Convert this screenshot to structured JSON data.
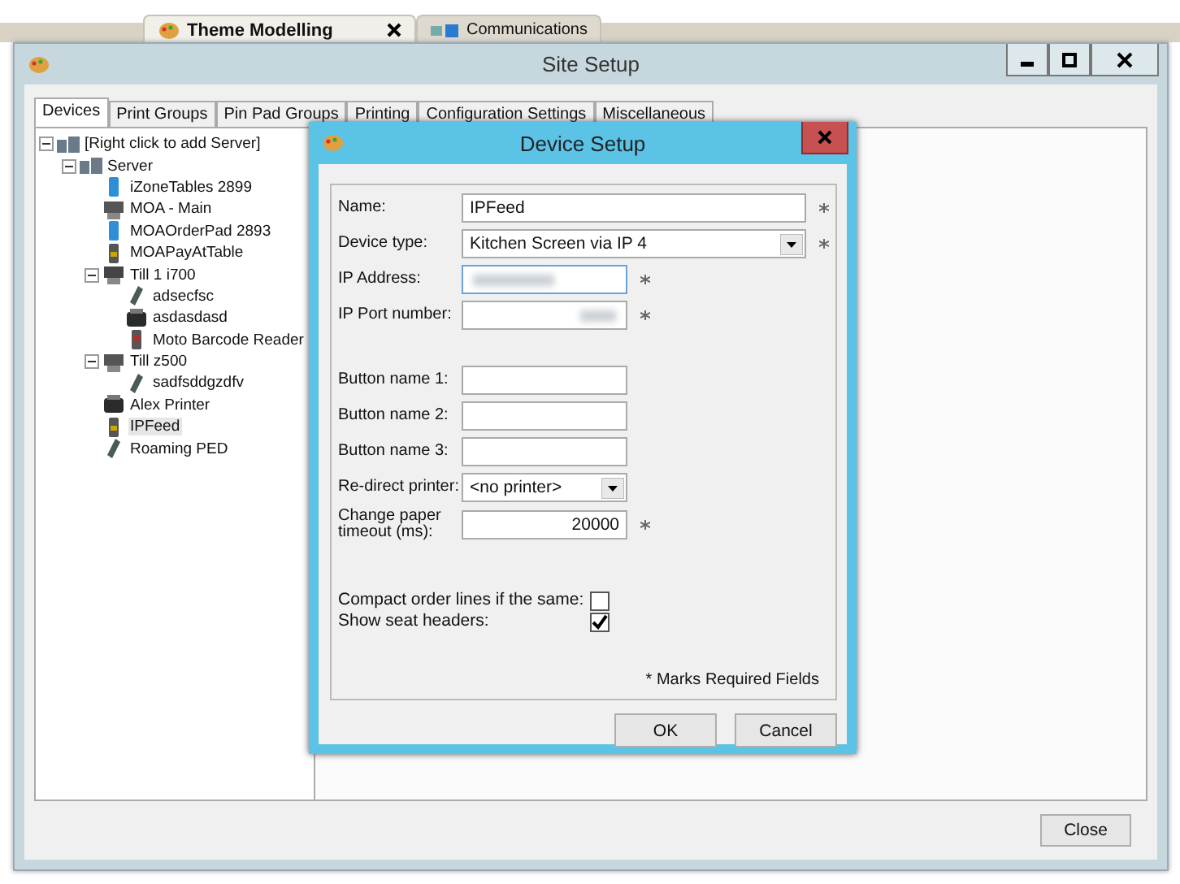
{
  "app_tabs": [
    {
      "label": "Theme Modelling",
      "selected": true,
      "closable": true
    },
    {
      "label": "Communications",
      "selected": false,
      "closable": false
    }
  ],
  "window": {
    "title": "Site Setup"
  },
  "tabs": [
    {
      "label": "Devices",
      "selected": true
    },
    {
      "label": "Print Groups",
      "selected": false
    },
    {
      "label": "Pin Pad Groups",
      "selected": false
    },
    {
      "label": "Printing",
      "selected": false
    },
    {
      "label": "Configuration Settings",
      "selected": false
    },
    {
      "label": "Miscellaneous",
      "selected": false
    }
  ],
  "tree": [
    {
      "label": "[Right click to add Server]",
      "kind": "server",
      "expanded": true,
      "selected": false,
      "children": [
        {
          "label": "Server",
          "kind": "server",
          "expanded": true,
          "selected": false,
          "children": [
            {
              "label": "iZoneTables 2899",
              "kind": "tablet",
              "selected": false
            },
            {
              "label": "MOA - Main",
              "kind": "terminal",
              "selected": false
            },
            {
              "label": "MOAOrderPad 2893",
              "kind": "tablet",
              "selected": false
            },
            {
              "label": "MOAPayAtTable",
              "kind": "payterminal",
              "selected": false
            },
            {
              "label": "Till 1 i700",
              "kind": "till",
              "expanded": true,
              "selected": false,
              "children": [
                {
                  "label": "adsecfsc",
                  "kind": "handheld",
                  "selected": false
                },
                {
                  "label": "asdasdasd",
                  "kind": "printer",
                  "selected": false
                },
                {
                  "label": "Moto Barcode Reader",
                  "kind": "scanner",
                  "selected": false
                }
              ]
            },
            {
              "label": "Till z500",
              "kind": "terminal",
              "expanded": true,
              "selected": false,
              "children": [
                {
                  "label": "sadfsddgzdfv",
                  "kind": "handheld",
                  "selected": false
                }
              ]
            },
            {
              "label": "Alex Printer",
              "kind": "printer",
              "selected": false
            },
            {
              "label": "IPFeed",
              "kind": "payterminal",
              "selected": true
            },
            {
              "label": "Roaming PED",
              "kind": "handheld",
              "selected": false
            }
          ]
        }
      ]
    }
  ],
  "dialog": {
    "title": "Device Setup",
    "fields": [
      {
        "label": "Name:",
        "kind": "text",
        "value": "IPFeed",
        "wide": true,
        "required": true,
        "right_aligned": false,
        "focused": false
      },
      {
        "label": "Device type:",
        "kind": "select",
        "value": "Kitchen Screen via IP 4",
        "wide": true,
        "required": true,
        "right_aligned": false,
        "focused": false
      },
      {
        "label": "IP Address:",
        "kind": "blurred",
        "wide": false,
        "required": true,
        "right_aligned": false,
        "focused": true
      },
      {
        "label": "IP Port number:",
        "kind": "blurred",
        "wide": false,
        "required": true,
        "right_aligned": true,
        "focused": false
      },
      {
        "label": "Button name 1:",
        "kind": "text",
        "wide": false,
        "required": false,
        "focused": false
      },
      {
        "label": "Button name 2:",
        "kind": "text",
        "wide": false,
        "required": false,
        "focused": false
      },
      {
        "label": "Button name 3:",
        "kind": "text",
        "wide": false,
        "required": false,
        "focused": false
      },
      {
        "label": "Re-direct printer:",
        "kind": "select",
        "value": "<no printer>",
        "wide": false,
        "required": false,
        "right_aligned": false,
        "focused": false
      },
      {
        "label": "Change paper timeout (ms):",
        "kind": "text",
        "value": "20000",
        "wide": false,
        "required": true,
        "right_aligned": true,
        "focused": false
      }
    ],
    "checks": [
      {
        "label": "Compact order lines if the same:",
        "checked": false
      },
      {
        "label": "Show seat headers:",
        "checked": true
      }
    ],
    "note": "* Marks Required Fields",
    "buttons": [
      "OK",
      "Cancel"
    ]
  },
  "close_button": "Close"
}
